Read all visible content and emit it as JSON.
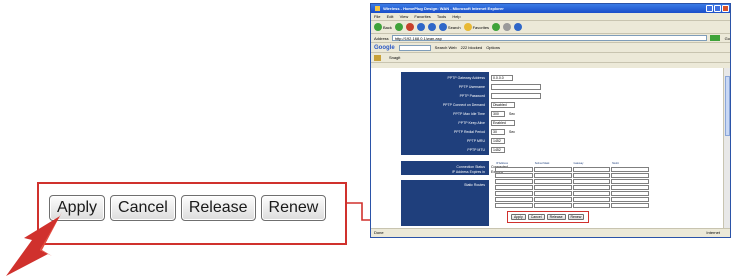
{
  "window": {
    "title": "Wireless - HomePlug Design: WAN - Microsoft Internet Explorer",
    "menu": [
      "File",
      "Edit",
      "View",
      "Favorites",
      "Tools",
      "Help"
    ],
    "toolbar": {
      "back": "Back",
      "search": "Search",
      "favorites": "Favorites"
    },
    "address_label": "Address",
    "address_value": "http://192.168.0.1/wan.asp",
    "go_label": "Go",
    "google_label": "Google",
    "google_search": "Search Web",
    "google_blocked": "222 blocked",
    "google_options": "Options",
    "links_label": "Snagit",
    "status_left": "Done",
    "status_right": "Internet"
  },
  "form": {
    "rows": [
      {
        "label": "PPTP Gateway Address",
        "value": "0.0.0.0"
      },
      {
        "label": "PPTP Username",
        "value": ""
      },
      {
        "label": "PPTP Password",
        "value": ""
      },
      {
        "label": "PPTP Connect on Demand",
        "value": "Disabled"
      },
      {
        "label": "PPTP Max Idle Time",
        "value": "300",
        "unit": "Sec"
      },
      {
        "label": "PPTP Keep Alive",
        "value": "Enabled"
      },
      {
        "label": "PPTP Redial Period",
        "value": "30",
        "unit": "Sec"
      },
      {
        "label": "PPTP MRU",
        "value": "1452"
      },
      {
        "label": "PPTP MTU",
        "value": "1452"
      }
    ],
    "status": [
      {
        "label": "Connection Status",
        "value": "Connected"
      },
      {
        "label": "IP Address Expires in",
        "value": "Expired"
      }
    ],
    "static_routes": {
      "label": "Static Routes",
      "headers": [
        "IP Address",
        "Subnet Mask",
        "Gateway",
        "Metric"
      ]
    }
  },
  "buttons": {
    "apply": "Apply",
    "cancel": "Cancel",
    "release": "Release",
    "renew": "Renew"
  },
  "colors": {
    "callout": "#d0312d",
    "navy": "#1f3f7c",
    "titlebar": "#2a5fd6"
  }
}
